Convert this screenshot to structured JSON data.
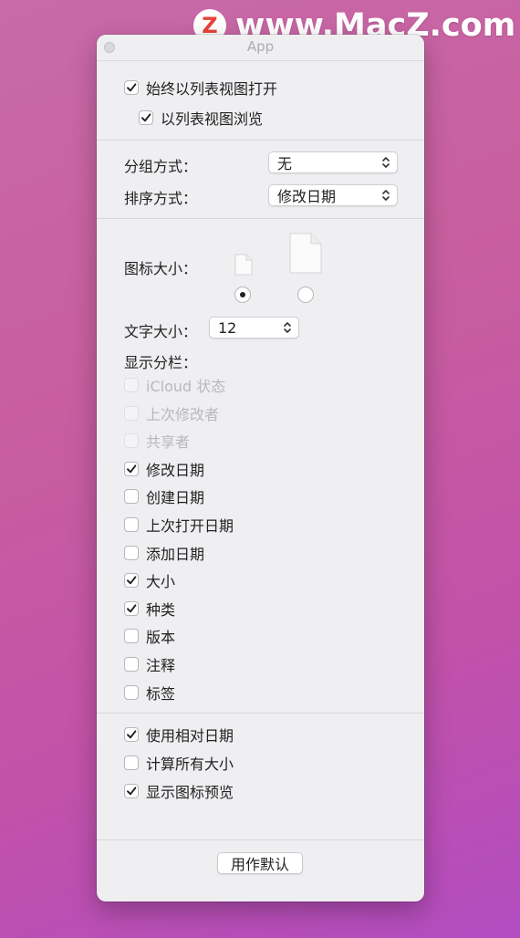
{
  "watermark": {
    "logo_letter": "Z",
    "text": "www.MacZ.com"
  },
  "window": {
    "title": "App"
  },
  "top_options": [
    {
      "label": "始终以列表视图打开",
      "checked": true
    },
    {
      "label": "以列表视图浏览",
      "checked": true
    }
  ],
  "group_by": {
    "label": "分组方式：",
    "value": "无"
  },
  "sort_by": {
    "label": "排序方式：",
    "value": "修改日期"
  },
  "icon_size": {
    "label": "图标大小：",
    "options": [
      {
        "name": "small",
        "selected": true
      },
      {
        "name": "large",
        "selected": false
      }
    ]
  },
  "text_size": {
    "label": "文字大小：",
    "value": "12"
  },
  "columns": {
    "label": "显示分栏：",
    "items": [
      {
        "label": "iCloud 状态",
        "checked": false,
        "disabled": true
      },
      {
        "label": "上次修改者",
        "checked": false,
        "disabled": true
      },
      {
        "label": "共享者",
        "checked": false,
        "disabled": true
      },
      {
        "label": "修改日期",
        "checked": true,
        "disabled": false
      },
      {
        "label": "创建日期",
        "checked": false,
        "disabled": false
      },
      {
        "label": "上次打开日期",
        "checked": false,
        "disabled": false
      },
      {
        "label": "添加日期",
        "checked": false,
        "disabled": false
      },
      {
        "label": "大小",
        "checked": true,
        "disabled": false
      },
      {
        "label": "种类",
        "checked": true,
        "disabled": false
      },
      {
        "label": "版本",
        "checked": false,
        "disabled": false
      },
      {
        "label": "注释",
        "checked": false,
        "disabled": false
      },
      {
        "label": "标签",
        "checked": false,
        "disabled": false
      }
    ]
  },
  "bottom_options": [
    {
      "label": "使用相对日期",
      "checked": true
    },
    {
      "label": "计算所有大小",
      "checked": false
    },
    {
      "label": "显示图标预览",
      "checked": true
    }
  ],
  "default_button": {
    "label": "用作默认"
  },
  "icons": {
    "checkbox": "checkmark-icon",
    "popup": "chevron-updown-icon",
    "document": "document-icon",
    "close": "close-button-icon"
  }
}
